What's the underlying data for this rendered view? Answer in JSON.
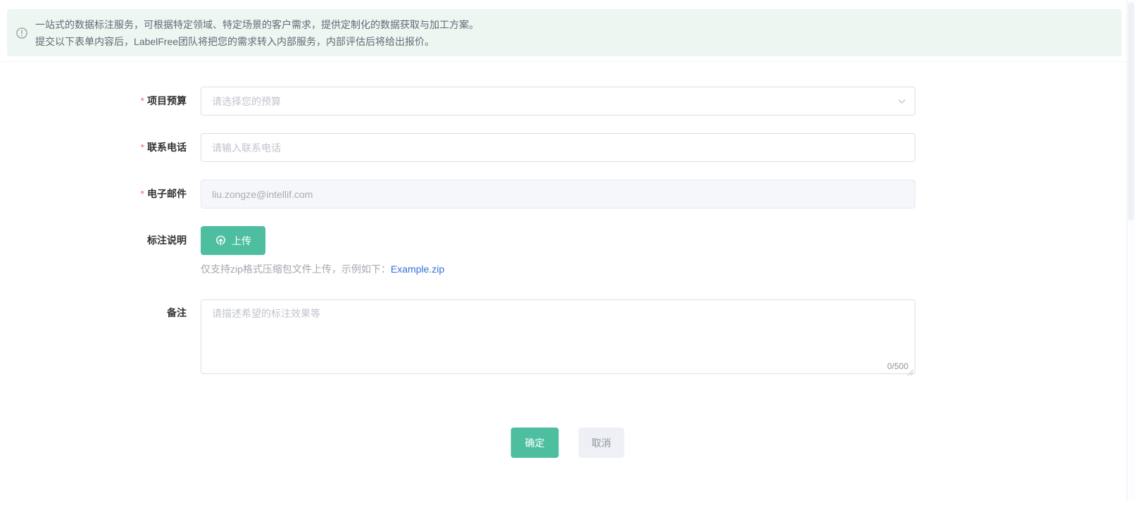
{
  "banner": {
    "line1": "一站式的数据标注服务，可根据特定领域、特定场景的客户需求，提供定制化的数据获取与加工方案。",
    "line2": "提交以下表单内容后，LabelFree团队将把您的需求转入内部服务，内部评估后将给出报价。"
  },
  "form": {
    "budget": {
      "label": "项目预算",
      "required_marker": "*",
      "placeholder": "请选择您的预算"
    },
    "phone": {
      "label": "联系电话",
      "required_marker": "*",
      "placeholder": "请输入联系电话"
    },
    "email": {
      "label": "电子邮件",
      "required_marker": "*",
      "value": "liu.zongze@intellif.com"
    },
    "upload": {
      "label": "标注说明",
      "button_label": "上传",
      "helper_text": "仅支持zip格式压缩包文件上传，示例如下：",
      "example_link": "Example.zip"
    },
    "remark": {
      "label": "备注",
      "placeholder": "请描述希望的标注效果等",
      "counter": "0/500"
    }
  },
  "footer": {
    "confirm_label": "确定",
    "cancel_label": "取消"
  },
  "colors": {
    "accent_green": "#4dbfa0",
    "link_blue": "#3370d9",
    "required_red": "#f56c6c",
    "banner_bg": "#edf6f1",
    "cancel_bg": "#eef0f5"
  }
}
